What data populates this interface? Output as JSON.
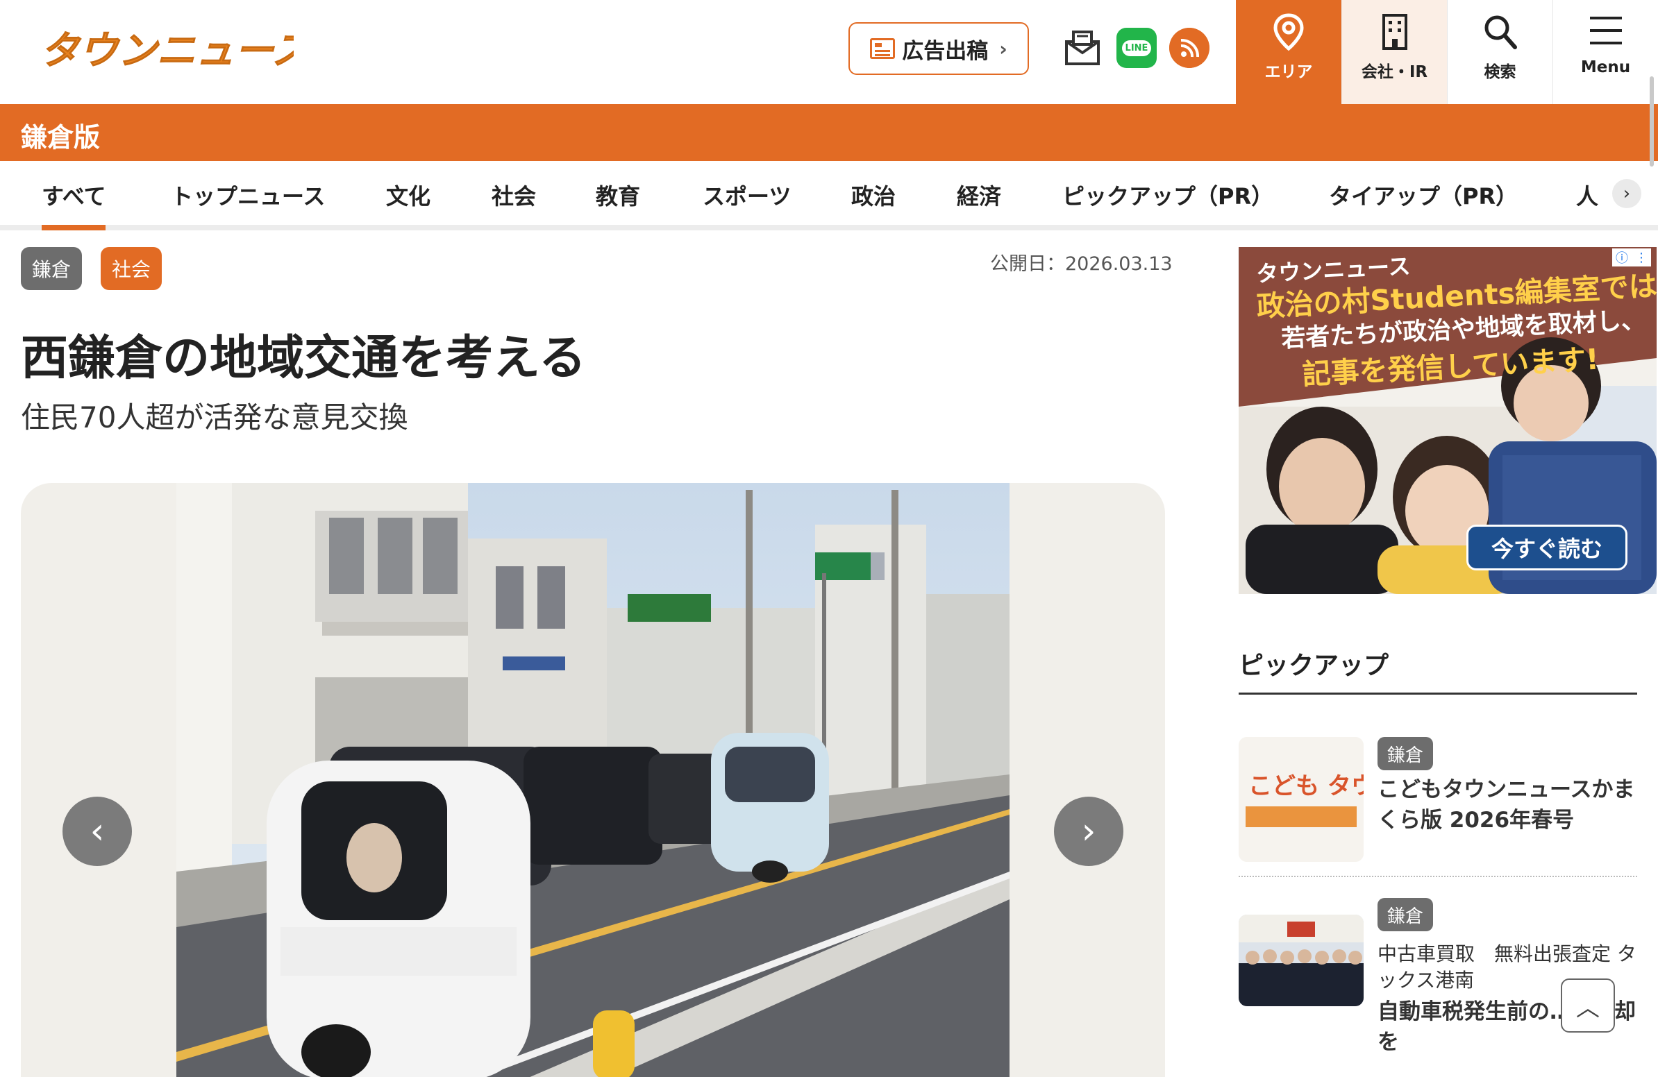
{
  "header": {
    "logo_text": "タウンニュース",
    "ad_button_label": "広告出稿",
    "icons": [
      "mail-icon",
      "line-icon",
      "rss-icon"
    ],
    "line_label": "LINE",
    "nav": [
      {
        "label": "エリア",
        "icon": "pin-icon"
      },
      {
        "label": "会社・IR",
        "icon": "building-icon"
      },
      {
        "label": "検索",
        "icon": "search-icon"
      },
      {
        "label": "Menu",
        "icon": "hamburger-icon"
      }
    ]
  },
  "edition": {
    "title": "鎌倉版"
  },
  "tabs": [
    {
      "label": "すべて",
      "active": true
    },
    {
      "label": "トップニュース"
    },
    {
      "label": "文化"
    },
    {
      "label": "社会"
    },
    {
      "label": "教育"
    },
    {
      "label": "スポーツ"
    },
    {
      "label": "政治"
    },
    {
      "label": "経済"
    },
    {
      "label": "ピックアップ（PR）"
    },
    {
      "label": "タイアップ（PR）"
    },
    {
      "label": "人"
    }
  ],
  "article": {
    "tags": [
      "鎌倉",
      "社会"
    ],
    "published": "公開日：2026.03.13",
    "title": "西鎌倉の地域交通を考える",
    "subtitle": "住民70人超が活発な意見交換"
  },
  "banner": {
    "line1": "タウンニュース",
    "line2": "政治の村Students編集室では",
    "line3": "若者たちが政治や地域を取材し、",
    "line4": "記事を発信しています!",
    "cta": "今すぐ読む"
  },
  "pickup": {
    "title": "ピックアップ",
    "items": [
      {
        "tag": "鎌倉",
        "title": "こどもタウンニュースかまくら版 2026年春号",
        "thumb_text": "こども タウンニュース"
      },
      {
        "tag": "鎌倉",
        "subtitle": "中古車買取　無料出張査定 タックス港南",
        "title": "自動車税発生前の…に売却を"
      }
    ]
  },
  "colors": {
    "brand": "#e26b24",
    "tag_gray": "#6d6d6d",
    "banner_bg": "#8b4a3c",
    "cta_blue": "#1d4f8e"
  }
}
